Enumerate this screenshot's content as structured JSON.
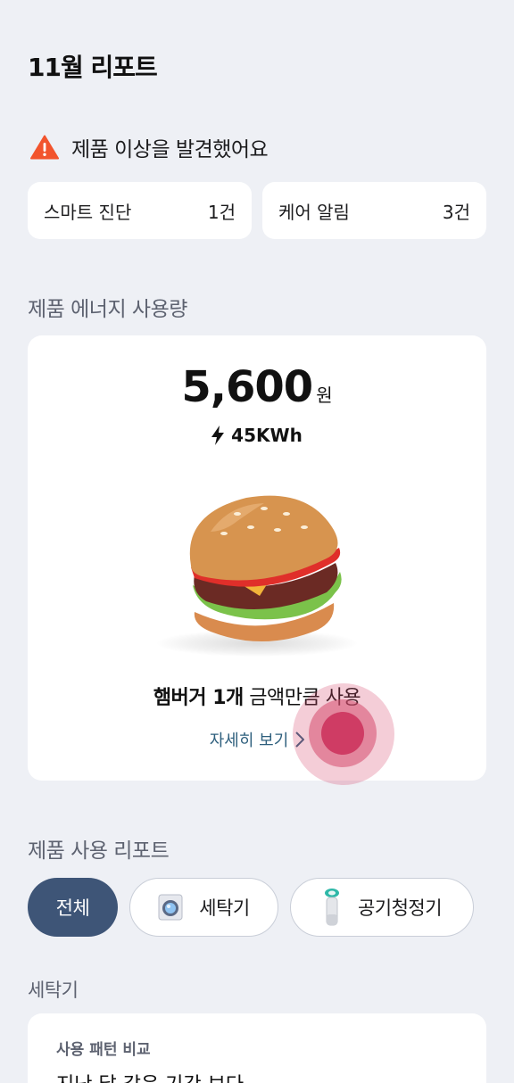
{
  "header": {
    "title": "11월 리포트"
  },
  "alert": {
    "icon": "warning-triangle-icon",
    "text": "제품 이상을 발견했어요",
    "color": "#f2542d"
  },
  "stats": [
    {
      "label": "스마트 진단",
      "value": "1건"
    },
    {
      "label": "케어 알림",
      "value": "3건"
    }
  ],
  "energy": {
    "section_title": "제품 에너지 사용량",
    "amount": "5,600",
    "unit": "원",
    "kwh": "45KWh",
    "kwh_icon": "lightning-bolt-icon",
    "illustration": "hamburger-illustration",
    "usage_bold": "햄버거 1개",
    "usage_rest": " 금액만큼 사용",
    "detail_label": "자세히 보기",
    "detail_icon": "chevron-right-icon"
  },
  "report": {
    "section_title": "제품 사용 리포트",
    "filters": [
      {
        "label": "전체",
        "active": true
      },
      {
        "label": "세탁기",
        "icon": "washer-icon"
      },
      {
        "label": "공기청정기",
        "icon": "air-purifier-icon"
      }
    ]
  },
  "washer": {
    "section_title": "세탁기",
    "card_subtitle": "사용 패턴 비교",
    "card_title": "지난 달 같은 기간 보다"
  },
  "colors": {
    "background": "#eef0f5",
    "accent": "#3e5577",
    "link": "#2e5f7d",
    "touch": "#cf3c64"
  }
}
